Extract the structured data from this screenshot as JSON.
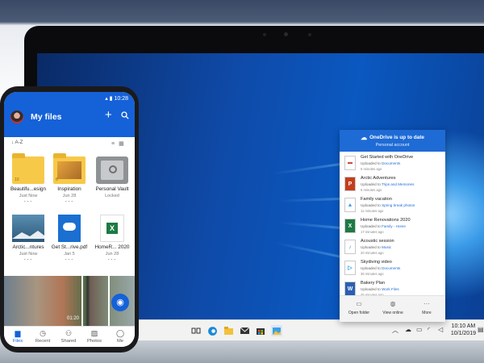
{
  "phone": {
    "time": "10:28",
    "title": "My files",
    "sort": "↓ A-Z",
    "tiles": [
      {
        "name": "Beautifu...esign",
        "sub": "Just Now",
        "badge": "10"
      },
      {
        "name": "Inspiration",
        "sub": "Jun 28",
        "badge": "8"
      },
      {
        "name": "Personal Vault",
        "sub": "Locked"
      },
      {
        "name": "Arctic...ntures",
        "sub": "Just Now"
      },
      {
        "name": "Get St...rive.pdf",
        "sub": "Jan 5"
      },
      {
        "name": "HomeR... 2020",
        "sub": "Jun 28"
      }
    ],
    "video_duration": "01:20",
    "nav": [
      {
        "label": "Files",
        "icon": "folder-icon"
      },
      {
        "label": "Recent",
        "icon": "clock-icon"
      },
      {
        "label": "Shared",
        "icon": "people-icon"
      },
      {
        "label": "Photos",
        "icon": "image-icon"
      },
      {
        "label": "Me",
        "icon": "person-icon"
      }
    ]
  },
  "flyout": {
    "title": "OneDrive is up to date",
    "subtitle": "Personal account",
    "items": [
      {
        "name": "Get Started with OneDrive",
        "prefix": "Uploaded to ",
        "folder": "Documents",
        "time": "5 minutes ago",
        "icon": "pdf-icon",
        "color": "#c0392b"
      },
      {
        "name": "Arctic Adventures",
        "prefix": "Uploaded to ",
        "folder": "Trips and Memories",
        "time": "6 minutes ago",
        "icon": "powerpoint-icon",
        "color": "#c43e1c"
      },
      {
        "name": "Family vacation",
        "prefix": "Uploaded to ",
        "folder": "Spring break photos",
        "time": "11 minutes ago",
        "icon": "photo-icon",
        "color": "#3aa0e8"
      },
      {
        "name": "Home Renovations 2020",
        "prefix": "Uploaded to ",
        "folder": "Family - Home",
        "time": "17 minutes ago",
        "icon": "excel-icon",
        "color": "#1d7a44"
      },
      {
        "name": "Acoustic session",
        "prefix": "Uploaded to ",
        "folder": "Music",
        "time": "20 minutes ago",
        "icon": "music-icon",
        "color": "#3aa0e8"
      },
      {
        "name": "Skydiving video",
        "prefix": "Uploaded to ",
        "folder": "Documents",
        "time": "36 minutes ago",
        "icon": "video-icon",
        "color": "#3aa0e8"
      },
      {
        "name": "Bakery Plan",
        "prefix": "Uploaded to ",
        "folder": "Work Files",
        "time": "45 minutes ago",
        "icon": "word-icon",
        "color": "#2b5fb4"
      }
    ],
    "footer": [
      {
        "label": "Open folder",
        "icon": "folder-icon"
      },
      {
        "label": "View online",
        "icon": "globe-icon"
      },
      {
        "label": "More",
        "icon": "more-icon"
      }
    ]
  },
  "taskbar": {
    "time": "10:10 AM",
    "date": "10/1/2019"
  },
  "colors": {
    "brand": "#1561d8",
    "flyout_header": "#1e6bd6"
  }
}
